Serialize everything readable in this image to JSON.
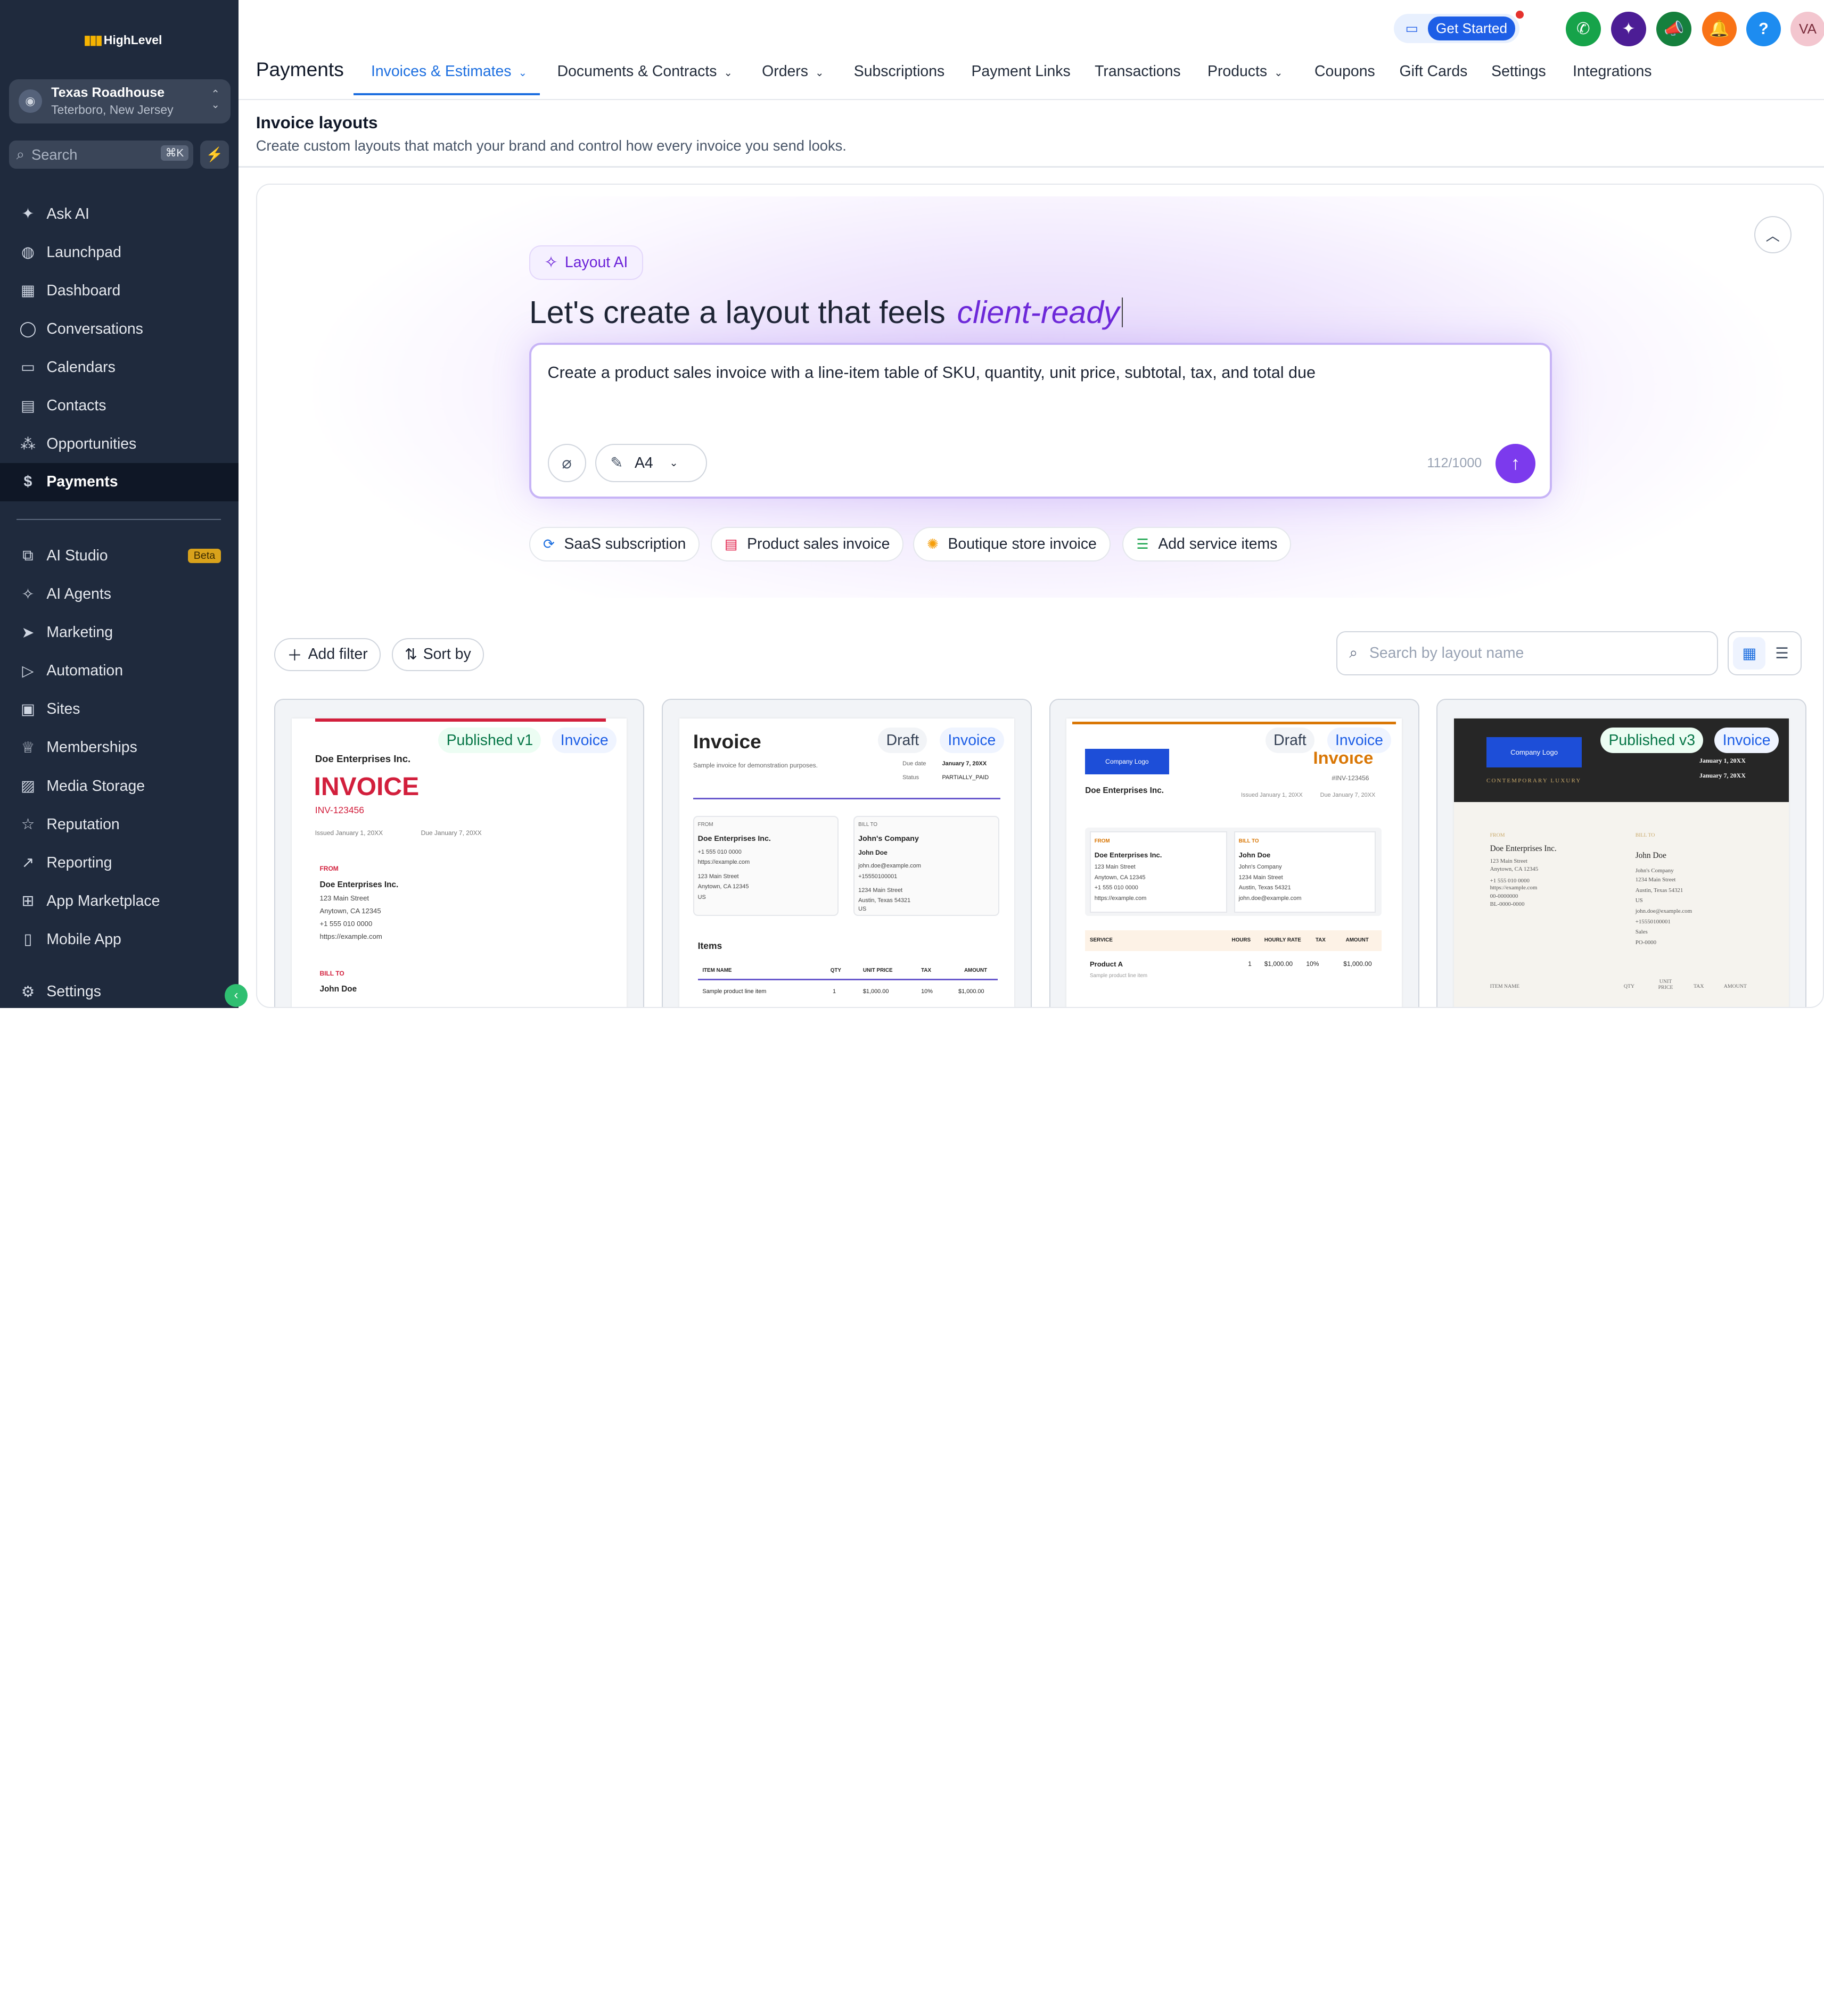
{
  "brand": {
    "logo_text": "HighLevel"
  },
  "account": {
    "name": "Texas Roadhouse",
    "location": "Teterboro, New Jersey"
  },
  "sidebar": {
    "search_placeholder": "Search",
    "search_shortcut": "⌘K",
    "items": [
      {
        "label": "Ask AI",
        "icon": "sparkle-icon"
      },
      {
        "label": "Launchpad",
        "icon": "rocket-icon"
      },
      {
        "label": "Dashboard",
        "icon": "grid-icon"
      },
      {
        "label": "Conversations",
        "icon": "chat-icon"
      },
      {
        "label": "Calendars",
        "icon": "calendar-icon"
      },
      {
        "label": "Contacts",
        "icon": "contacts-icon"
      },
      {
        "label": "Opportunities",
        "icon": "funnel-icon"
      },
      {
        "label": "Payments",
        "icon": "payments-icon"
      }
    ],
    "items2": [
      {
        "label": "AI Studio",
        "icon": "ai-studio-icon",
        "badge": "Beta"
      },
      {
        "label": "AI Agents",
        "icon": "agents-icon"
      },
      {
        "label": "Marketing",
        "icon": "send-icon"
      },
      {
        "label": "Automation",
        "icon": "automation-icon"
      },
      {
        "label": "Sites",
        "icon": "sites-icon"
      },
      {
        "label": "Memberships",
        "icon": "membership-icon"
      },
      {
        "label": "Media Storage",
        "icon": "image-icon"
      },
      {
        "label": "Reputation",
        "icon": "star-icon"
      },
      {
        "label": "Reporting",
        "icon": "chart-icon"
      },
      {
        "label": "App Marketplace",
        "icon": "apps-icon"
      },
      {
        "label": "Mobile App",
        "icon": "mobile-icon"
      }
    ],
    "settings": "Settings"
  },
  "header": {
    "get_started": "Get Started",
    "avatar": "VA",
    "page": "Payments",
    "tabs": [
      "Invoices & Estimates",
      "Documents & Contracts",
      "Orders",
      "Subscriptions",
      "Payment Links",
      "Transactions",
      "Products",
      "Coupons",
      "Gift Cards",
      "Settings",
      "Integrations"
    ]
  },
  "page": {
    "title": "Invoice layouts",
    "subtitle": "Create custom layouts that match your brand and control how every invoice you send looks."
  },
  "ai": {
    "pill": "Layout AI",
    "heading": "Let's create a layout that feels",
    "heading_em": "client-ready",
    "prompt": "Create a product sales invoice with a line-item table of SKU, quantity, unit price, subtotal, tax, and total due",
    "page_size": "A4",
    "counter": "112/1000",
    "suggestions": [
      "SaaS subscription",
      "Product sales invoice",
      "Boutique store invoice",
      "Add service items"
    ]
  },
  "list": {
    "add_filter": "Add filter",
    "sort_by": "Sort by",
    "search_placeholder": "Search by layout name"
  },
  "cards": [
    {
      "status": "Published v1",
      "type": "Invoice"
    },
    {
      "status": "Draft",
      "type": "Invoice"
    },
    {
      "status": "Draft",
      "type": "Invoice"
    },
    {
      "status": "Published v3",
      "type": "Invoice"
    }
  ],
  "previews": {
    "c1": {
      "company": "Doe Enterprises Inc.",
      "title": "INVOICE",
      "number": "INV-123456",
      "issued": "Issued January 1, 20XX",
      "due": "Due January 7, 20XX",
      "from": "FROM",
      "from_name": "Doe Enterprises Inc.",
      "addr1": "123 Main Street",
      "addr2": "Anytown, CA 12345",
      "phone": "+1 555 010 0000",
      "web": "https://example.com",
      "bill_to": "BILL TO",
      "bill_name": "John Doe"
    },
    "c2": {
      "title": "Invoice",
      "sub": "Sample invoice for demonstration purposes.",
      "due_label": "Due date",
      "due": "January 7, 20XX",
      "status_label": "Status",
      "status": "PARTIALLY_PAID",
      "from": "FROM",
      "from_name": "Doe Enterprises Inc.",
      "from_l1": "+1 555 010 0000",
      "from_l2": "https://example.com",
      "from_l3": "123 Main Street",
      "from_l4": "Anytown, CA 12345",
      "from_l5": "US",
      "bill": "BILL TO",
      "bill_co": "John's Company",
      "bill_name": "John Doe",
      "bill_l1": "john.doe@example.com",
      "bill_l2": "+15550100001",
      "bill_l3": "1234 Main Street",
      "bill_l4": "Austin, Texas 54321",
      "bill_l5": "US",
      "items": "Items",
      "h_item": "ITEM NAME",
      "h_qty": "QTY",
      "h_price": "UNIT PRICE",
      "h_tax": "TAX",
      "h_amt": "AMOUNT",
      "r_item": "Sample product line item",
      "r_qty": "1",
      "r_price": "$1,000.00",
      "r_tax": "10%",
      "r_amt": "$1,000.00"
    },
    "c3": {
      "logo": "Company Logo",
      "title": "Invoice",
      "number": "#INV-123456",
      "company": "Doe Enterprises Inc.",
      "issued": "Issued January 1, 20XX",
      "due": "Due January 7, 20XX",
      "from": "FROM",
      "from_name": "Doe Enterprises Inc.",
      "f1": "123 Main Street",
      "f2": "Anytown, CA 12345",
      "f3": "+1 555 010 0000",
      "f4": "https://example.com",
      "bill": "BILL TO",
      "bill_name": "John Doe",
      "b1": "John's Company",
      "b2": "1234 Main Street",
      "b3": "Austin, Texas 54321",
      "b4": "john.doe@example.com",
      "h_service": "SERVICE",
      "h_hours": "HOURS",
      "h_rate": "HOURLY RATE",
      "h_tax": "TAX",
      "h_amt": "AMOUNT",
      "r_name": "Product A",
      "r_sub": "Sample product line item",
      "r_hours": "1",
      "r_rate": "$1,000.00",
      "r_tax": "10%",
      "r_amt": "$1,000.00"
    },
    "c4": {
      "logo": "Company Logo",
      "tagline": "CONTEMPORARY LUXURY",
      "d1": "January 1, 20XX",
      "d2": "January 7, 20XX",
      "from": "FROM",
      "from_name": "Doe Enterprises Inc.",
      "f1": "123 Main Street",
      "f2": "Anytown, CA 12345",
      "f3": "+1 555 010 0000",
      "f4": "https://example.com",
      "f5": "00-0000000",
      "f6": "BL-0000-0000",
      "bill": "BILL TO",
      "bill_name": "John Doe",
      "b1": "John's Company",
      "b2": "1234 Main Street",
      "b3": "Austin, Texas 54321",
      "b4": "US",
      "b5": "john.doe@example.com",
      "b6": "+15550100001",
      "b7": "Sales",
      "b8": "PO-0000",
      "h_item": "ITEM NAME",
      "h_qty": "QTY",
      "h_unit": "UNIT PRICE",
      "h_tax": "TAX",
      "h_amt": "AMOUNT"
    }
  },
  "colors": {
    "sidebar": "#1f2a3d",
    "accent": "#1d6fe0",
    "ai": "#7c3aed",
    "invoice_red": "#d21f3c",
    "invoice_orange": "#d97706"
  }
}
